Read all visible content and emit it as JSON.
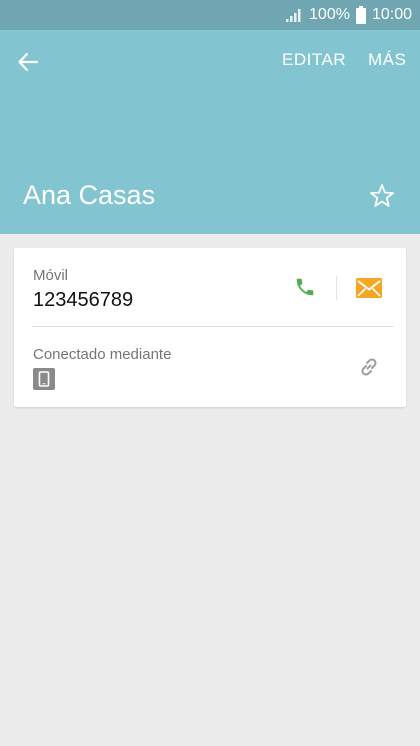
{
  "status_bar": {
    "battery_percent": "100%",
    "time": "10:00",
    "icons": [
      "signal-icon",
      "battery-icon"
    ]
  },
  "header": {
    "back_icon": "arrow-left-icon",
    "edit_label": "EDITAR",
    "more_label": "MÁS",
    "contact_name": "Ana Casas",
    "favorite_icon": "star-outline-icon"
  },
  "card": {
    "phone": {
      "label": "Móvil",
      "number": "123456789",
      "call_icon": "phone-icon",
      "message_icon": "envelope-icon"
    },
    "linked": {
      "label": "Conectado mediante",
      "device_icon": "phone-device-icon",
      "link_icon": "link-icon"
    }
  },
  "colors": {
    "status_bar": "#6fa6b1",
    "header": "#82c5d0",
    "background": "#ececec",
    "call": "#4caf50",
    "message": "#f5a623",
    "link_icon": "#9e9e9e"
  }
}
